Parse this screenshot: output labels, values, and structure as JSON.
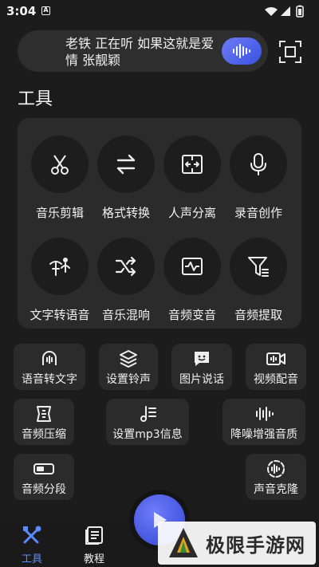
{
  "status_bar": {
    "time": "3:04",
    "badge": "A"
  },
  "search": {
    "now_playing": "老铁 正在听 如果这就是爱情 张靓颖"
  },
  "section_title": "工具",
  "tools": [
    {
      "label": "音乐剪辑",
      "icon": "scissors-icon"
    },
    {
      "label": "格式转换",
      "icon": "swap-icon"
    },
    {
      "label": "人声分离",
      "icon": "split-icon"
    },
    {
      "label": "录音创作",
      "icon": "mic-icon"
    },
    {
      "label": "文字转语音",
      "icon": "text-to-speech-icon"
    },
    {
      "label": "音乐混响",
      "icon": "shuffle-icon"
    },
    {
      "label": "音频变音",
      "icon": "waveform-box-icon"
    },
    {
      "label": "音频提取",
      "icon": "filter-icon"
    }
  ],
  "chips": [
    {
      "label": "语音转文字",
      "icon": "speech-to-text-icon"
    },
    {
      "label": "设置铃声",
      "icon": "layers-icon"
    },
    {
      "label": "图片说话",
      "icon": "chat-face-icon"
    },
    {
      "label": "视频配音",
      "icon": "video-audio-icon"
    },
    {
      "label": "音频压缩",
      "icon": "compress-icon"
    },
    {
      "label": "设置mp3信息",
      "icon": "music-list-icon"
    },
    {
      "label": "降噪增强音质",
      "icon": "equalizer-icon"
    },
    {
      "label": "音频分段",
      "icon": "toggle-icon"
    },
    {
      "label": "声音克隆",
      "icon": "clone-wave-icon"
    }
  ],
  "bottom_nav": [
    {
      "label": "工具",
      "active": true
    },
    {
      "label": "教程",
      "active": false
    }
  ],
  "watermark": {
    "text": "极限手游网"
  },
  "colors": {
    "accent": "#4a60ea",
    "active_nav": "#5b8cff",
    "panel": "#2b2b2b",
    "background": "#1c1c1c"
  }
}
